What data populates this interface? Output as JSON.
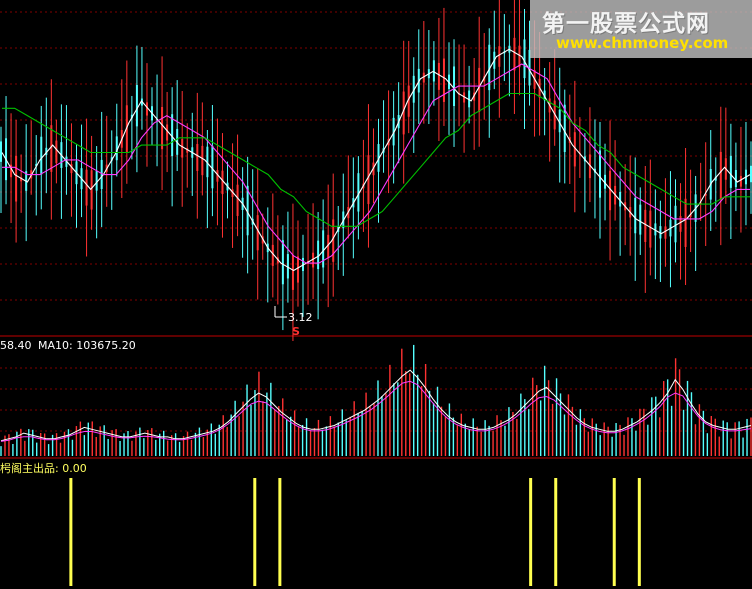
{
  "watermark": {
    "title": "第一股票公式网",
    "url": "www.chnmoney.com"
  },
  "colors": {
    "background": "#000000",
    "up": "#ff3232",
    "down": "#54ffff",
    "ma_white": "#ffffff",
    "ma_magenta": "#ff3cff",
    "ma_green": "#00c000",
    "signal": "#ffff50",
    "grid": "#800000",
    "divider": "#c00000"
  },
  "price_panel": {
    "low_marker": "3.12",
    "signal_marker": "S"
  },
  "volume_panel": {
    "legend_prefix": "58.40",
    "legend_ma10": "MA10: 103675.20"
  },
  "indicator_panel": {
    "legend": "枵阁主出品: 0.00"
  },
  "chart_data": [
    {
      "type": "line",
      "panel": "price",
      "annotations": [
        "3.12",
        "S"
      ],
      "series": [
        {
          "name": "",
          "color": "#ffffff",
          "values": [
            60,
            57,
            56,
            59,
            61,
            59,
            57,
            55,
            57,
            60,
            64,
            67,
            65,
            63,
            61,
            60,
            59,
            57,
            55,
            53,
            50,
            47,
            45,
            44,
            45,
            46,
            48,
            51,
            54,
            57,
            60,
            63,
            67,
            70,
            71,
            70,
            68,
            67,
            70,
            73,
            74,
            73,
            70,
            67,
            64,
            61,
            59,
            57,
            55,
            53,
            51,
            50,
            49,
            50,
            51,
            53,
            56,
            58,
            56,
            57
          ]
        },
        {
          "name": "",
          "color": "#ff3cff",
          "values": [
            58,
            58,
            57,
            57,
            58,
            59,
            59,
            58,
            57,
            57,
            59,
            62,
            64,
            65,
            64,
            63,
            62,
            60,
            58,
            56,
            53,
            50,
            48,
            46,
            45,
            45,
            46,
            48,
            50,
            52,
            55,
            58,
            61,
            64,
            67,
            68,
            69,
            69,
            69,
            70,
            71,
            72,
            71,
            70,
            67,
            64,
            62,
            60,
            58,
            56,
            54,
            53,
            52,
            51,
            51,
            51,
            52,
            54,
            55,
            55
          ]
        },
        {
          "name": "",
          "color": "#00c000",
          "values": [
            66,
            66,
            65,
            64,
            63,
            62,
            61,
            60,
            60,
            60,
            60,
            61,
            61,
            61,
            62,
            62,
            62,
            61,
            60,
            59,
            58,
            57,
            55,
            54,
            52,
            51,
            50,
            50,
            50,
            51,
            52,
            54,
            56,
            58,
            60,
            62,
            63,
            65,
            66,
            67,
            68,
            68,
            68,
            67,
            66,
            64,
            63,
            61,
            60,
            58,
            57,
            56,
            55,
            54,
            53,
            53,
            53,
            54,
            54,
            54
          ]
        }
      ]
    },
    {
      "type": "bar",
      "panel": "volume",
      "values": [
        8,
        9,
        10,
        12,
        11,
        10,
        9,
        9,
        10,
        11,
        13,
        15,
        14,
        13,
        12,
        11,
        10,
        10,
        11,
        12,
        11,
        10,
        10,
        9,
        9,
        10,
        11,
        12,
        13,
        15,
        18,
        22,
        26,
        30,
        33,
        31,
        27,
        23,
        20,
        17,
        15,
        14,
        14,
        15,
        16,
        18,
        20,
        22,
        24,
        27,
        30,
        34,
        38,
        42,
        45,
        41,
        36,
        30,
        25,
        21,
        18,
        16,
        15,
        14,
        14,
        15,
        17,
        19,
        22,
        26,
        30,
        34,
        36,
        32,
        28,
        24,
        20,
        17,
        15,
        14,
        13,
        13,
        14,
        16,
        18,
        21,
        24,
        28,
        33,
        40,
        35,
        28,
        22,
        18,
        16,
        15,
        14,
        14,
        15,
        16
      ]
    },
    {
      "type": "bar",
      "panel": "indicator",
      "values": [
        0,
        0,
        0,
        0,
        0,
        0,
        0,
        0,
        1,
        0,
        0,
        0,
        0,
        0,
        0,
        0,
        0,
        0,
        0,
        0,
        0,
        0,
        0,
        0,
        0,
        0,
        0,
        0,
        0,
        0,
        1,
        0,
        0,
        1,
        0,
        0,
        0,
        0,
        0,
        0,
        0,
        0,
        0,
        0,
        0,
        0,
        0,
        0,
        0,
        0,
        0,
        0,
        0,
        0,
        0,
        0,
        0,
        0,
        0,
        0,
        0,
        0,
        0,
        1,
        0,
        0,
        1,
        0,
        0,
        0,
        0,
        0,
        0,
        1,
        0,
        0,
        1,
        0,
        0,
        0,
        0,
        0,
        0,
        0,
        0,
        0,
        0,
        0,
        0,
        0
      ]
    }
  ]
}
